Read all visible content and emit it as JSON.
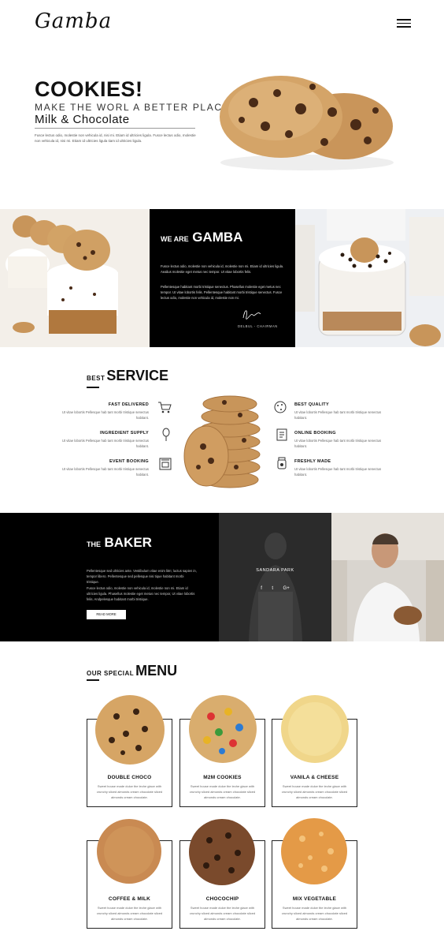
{
  "header": {
    "logo": "Gamba",
    "menu_icon": "hamburger-icon"
  },
  "hero": {
    "title": "COOKIES!",
    "subtitle": "MAKE THE WORL A BETTER PLACE",
    "tagline": "Milk & Chocolate",
    "text": "Fusce lectus odio, molestie non vehicula id, nisi mi. Etiam id ultricies ligula. Fusce lectus odio, molestie non vehicula id, nisi mi. Etiam id ultricies ligula tiam id ultricies ligula."
  },
  "about": {
    "heading_prefix": "WE ARE",
    "heading": "GAMBA",
    "paragraph1": "Fusce lectus odio, molestie non vehicula id, molestie non mi. Etiam id ultricies ligula. Aealius molestie eget metus nec tempor. Ut vitae lobortis felis.",
    "paragraph2": "Pellentesque habitant morbi tristique senectus. Phasellus molestie eget metus nec tempor. Ut vitae lobortis felis. Pellentesque habitant morbi tristique senectus. Fusce lectus odio, molestie non vehicula id, molestie non mi.",
    "signer": "DELBUL - CHAIRMAN"
  },
  "service": {
    "heading_prefix": "BEST",
    "heading": "SERVICE",
    "left": [
      {
        "title": "FAST DELIVERED",
        "text": "Ut vitae lobortis Pellesque hab tant morbi tristique senectus habitant.",
        "icon": "cart-icon"
      },
      {
        "title": "INGREDIENT SUPPLY",
        "text": "Ut vitae lobortis Pellesque hab tant morbi tristique senectus habitant.",
        "icon": "whisk-icon"
      },
      {
        "title": "EVENT BOOKING",
        "text": "Ut vitae lobortis Pellesque hab tant morbi tristique senectus habitant.",
        "icon": "oven-icon"
      }
    ],
    "right": [
      {
        "title": "BEST QUALITY",
        "text": "Ut vitae lobortis Pellesque hab tant morbi tristique senectus habitant.",
        "icon": "cookie-icon"
      },
      {
        "title": "ONLINE BOOKING",
        "text": "Ut vitae lobortis Pellesque hab tant morbi tristique senectus habitant.",
        "icon": "book-icon"
      },
      {
        "title": "FRESHLY MADE",
        "text": "Ut vitae lobortis Pellesque hab tant morbi tristique senectus habitant.",
        "icon": "jar-icon"
      }
    ]
  },
  "baker": {
    "heading_prefix": "THE",
    "heading": "BAKER",
    "paragraph1": "Pellentesque sed ultricies ante. Vestibulum vitae enim litm; luctus sapien in, tempor libero. Pellentesque sed pellesque nisi tique habitant morbi tristique.",
    "paragraph2": "Fusce lectus odio, molestie non vehicula id, molestie non mi. Etiam id ultricies ligula. Phasellus molestie eget metus nec tempor, Ut vitae lobortis felis. Andpelesque habitant morbi tristique.",
    "button": "READ MORE",
    "member_name": "SANDARA PARK",
    "social": [
      "f",
      "t",
      "G+"
    ]
  },
  "menu": {
    "heading_prefix": "OUR SPECIAL",
    "heading": "MENU",
    "items": [
      {
        "name": "DOUBLE CHOCO",
        "desc": "Sweet house made dulce the leche glace with crunchy sliced almonds cream chocolate sliced almonds cream chocolate."
      },
      {
        "name": "M2M COOKIES",
        "desc": "Sweet house made dulce the leche glace with crunchy sliced almonds cream chocolate sliced almonds cream chocolate."
      },
      {
        "name": "VANILA & CHEESE",
        "desc": "Sweet house made dulce the leche glace with crunchy sliced almonds cream chocolate sliced almonds cream chocolate."
      },
      {
        "name": "COFFEE & MILK",
        "desc": "Sweet house made dulce the leche glace with crunchy sliced almonds cream chocolate sliced almonds cream chocolate."
      },
      {
        "name": "CHOCOCHIP",
        "desc": "Sweet house made dulce the leche glace with crunchy sliced almonds cream chocolate sliced almonds cream chocolate."
      },
      {
        "name": "MIX VEGETABLE",
        "desc": "Sweet house made dulce the leche glace with crunchy sliced almonds cream chocolate sliced almonds cream chocolate."
      }
    ]
  }
}
